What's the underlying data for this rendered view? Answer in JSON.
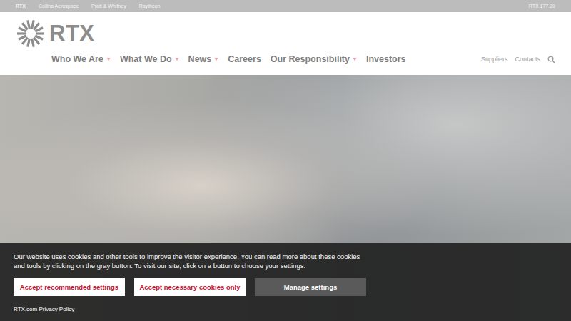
{
  "top_bar": {
    "links": [
      {
        "label": "RTX",
        "selected": true
      },
      {
        "label": "Collins Aerospace",
        "selected": false
      },
      {
        "label": "Pratt & Whitney",
        "selected": false
      },
      {
        "label": "Raytheon",
        "selected": false
      }
    ],
    "stock": "RTX 177.20"
  },
  "logo": {
    "text": "RTX"
  },
  "nav": {
    "items": [
      {
        "label": "Who We Are",
        "has_menu": true
      },
      {
        "label": "What We Do",
        "has_menu": true
      },
      {
        "label": "News",
        "has_menu": true
      },
      {
        "label": "Careers",
        "has_menu": false
      },
      {
        "label": "Our Responsibility",
        "has_menu": true
      },
      {
        "label": "Investors",
        "has_menu": false
      }
    ],
    "utility": [
      "Suppliers",
      "Contacts"
    ]
  },
  "cookie_banner": {
    "message": "Our website uses cookies and other tools to improve the visitor experience. You can read more about these cookies and tools by clicking on the gray button. To visit our site, click on a button to choose your settings.",
    "buttons": [
      {
        "label": "Accept recommended settings",
        "kind": "light"
      },
      {
        "label": "Accept necessary cookies only",
        "kind": "light"
      },
      {
        "label": "Manage settings",
        "kind": "gray"
      }
    ],
    "link": "RTX.com Privacy Policy"
  }
}
